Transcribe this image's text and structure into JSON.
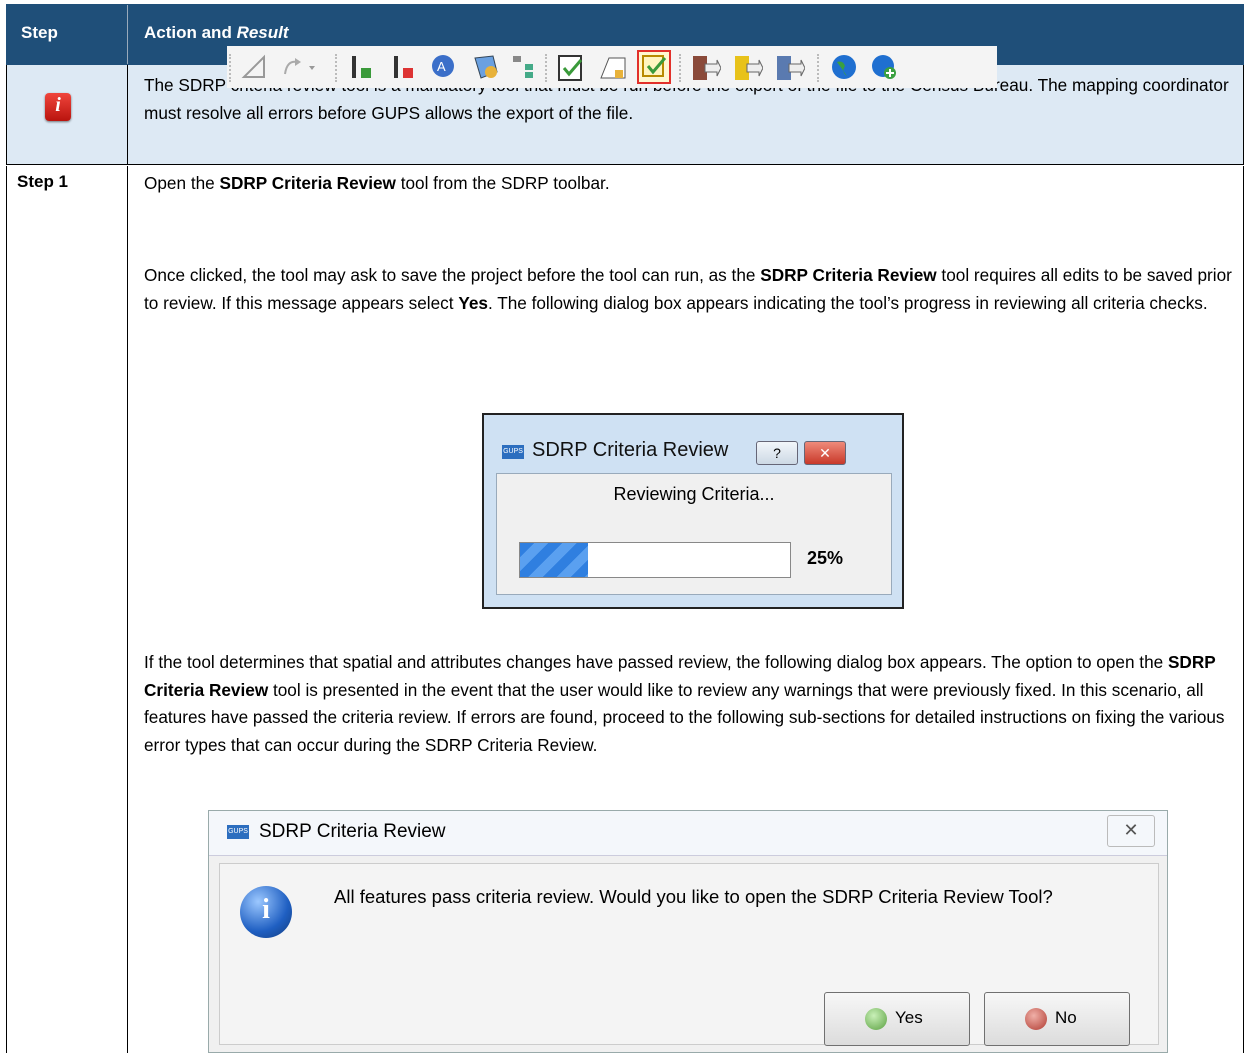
{
  "header": {
    "col1": "Step",
    "col2_plain": "Action and ",
    "col2_italic": "Result"
  },
  "note": {
    "icon": "info-icon",
    "text": "The SDRP criteria review tool is a mandatory tool that must be run before the export of the file to the Census Bureau. The mapping coordinator must resolve all errors before GUPS allows the export of the file."
  },
  "step1": {
    "label": "Step 1",
    "p1_a": "Open the ",
    "p1_b": "SDRP Criteria Review",
    "p1_c": " tool from the SDRP toolbar.",
    "p2_a": "Once clicked, the tool may ask to save the project before the tool can run, as the ",
    "p2_b": "SDRP Criteria Review",
    "p2_c": " tool requires all edits to be saved prior to review. If this message appears select ",
    "p2_d": "Yes",
    "p2_e": ". The following dialog box appears indicating the tool’s progress in reviewing all criteria checks.",
    "p3_a": "If the tool determines that spatial and attributes changes have passed review, the following dialog box appears. The option to open the ",
    "p3_b": "SDRP Criteria Review",
    "p3_c": " tool is presented in the event that the user would like to review any warnings that were previously fixed. In this scenario, all features have passed the criteria review. If errors are found, proceed to the following sub-sections for detailed instructions on fixing the various error types that can occur during the SDRP Criteria Review."
  },
  "progress_dialog": {
    "title": "SDRP Criteria Review",
    "help": "?",
    "close": "✕",
    "message": "Reviewing Criteria...",
    "progress": 0.25,
    "percent_label": "25%"
  },
  "result_dialog": {
    "title": "SDRP Criteria Review",
    "close": "✕",
    "message": "All features pass criteria review. Would you like to open the SDRP Criteria Review Tool?",
    "yes": "Yes",
    "no": "No"
  },
  "toolbar_icons": [
    "measure-icon",
    "select-arrow-icon",
    "add-line-icon",
    "delete-line-icon",
    "attribute-icon",
    "polygon-icon",
    "hierarchy-icon",
    "review-check-icon",
    "edit-shape-icon",
    "criteria-review-icon",
    "export-icon",
    "export-zip-icon",
    "export-arrow-icon",
    "globe-icon",
    "globe-add-icon"
  ],
  "gups_logo": "GUPS"
}
